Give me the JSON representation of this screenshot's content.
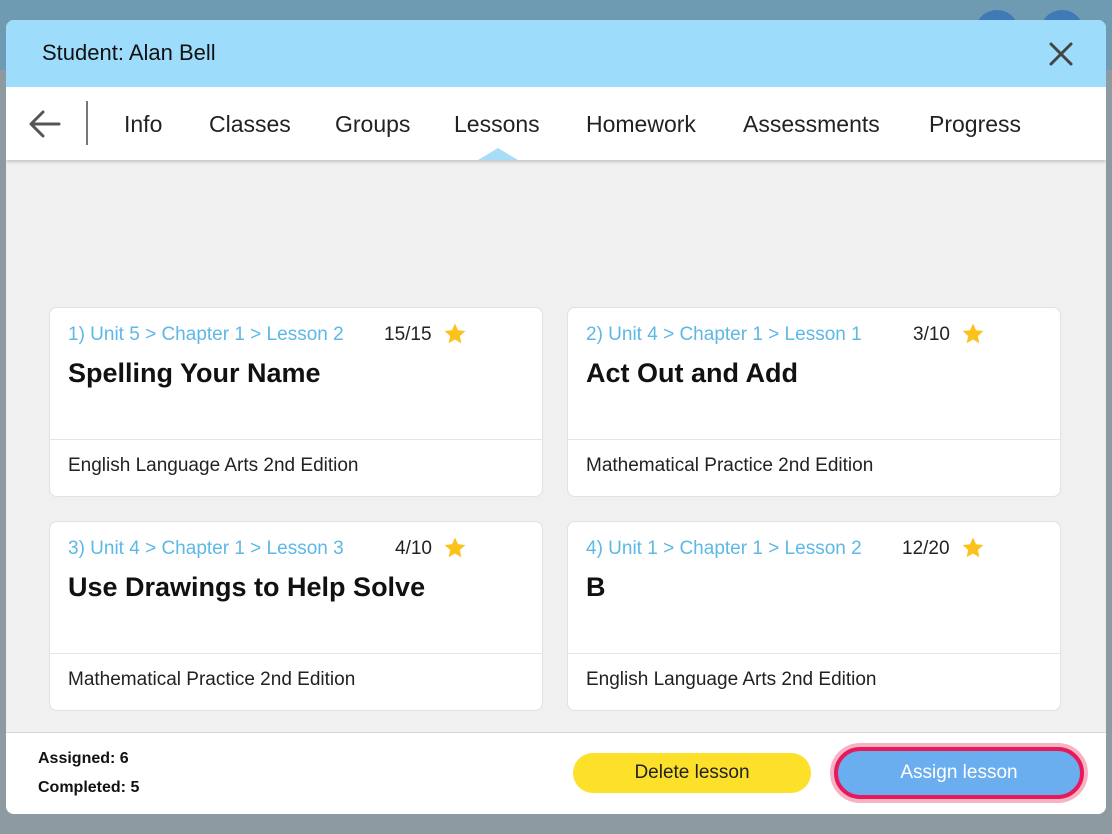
{
  "modal": {
    "title": "Student: Alan Bell"
  },
  "tabs": [
    {
      "label": "Info"
    },
    {
      "label": "Classes"
    },
    {
      "label": "Groups"
    },
    {
      "label": "Lessons"
    },
    {
      "label": "Homework"
    },
    {
      "label": "Assessments"
    },
    {
      "label": "Progress"
    }
  ],
  "active_tab": "Lessons",
  "lessons": [
    {
      "path": "1) Unit 5 > Chapter 1 > Lesson 2",
      "score": "15/15",
      "title": "Spelling Your Name",
      "course": "English Language Arts 2nd Edition"
    },
    {
      "path": "2) Unit 4 > Chapter 1 > Lesson 1",
      "score": "3/10",
      "title": "Act Out and Add",
      "course": "Mathematical Practice 2nd Edition"
    },
    {
      "path": "3) Unit 4 > Chapter 1 > Lesson 3",
      "score": "4/10",
      "title": "Use Drawings to Help Solve",
      "course": "Mathematical Practice 2nd Edition"
    },
    {
      "path": "4) Unit 1 > Chapter 1 > Lesson 2",
      "score": "12/20",
      "title": "B",
      "course": "English Language Arts 2nd Edition"
    }
  ],
  "footer": {
    "assigned": "Assigned: 6",
    "completed": "Completed: 5",
    "delete_label": "Delete lesson",
    "assign_label": "Assign lesson"
  },
  "colors": {
    "header_bg": "#9edcfc",
    "path_text": "#5db8e6",
    "star": "#fbc21b",
    "delete_button": "#fde02a",
    "assign_button": "#6aaef0",
    "assign_highlight": "#e8195a"
  },
  "icons": {
    "close": "close-icon",
    "back": "arrow-left-icon",
    "star": "star-icon"
  }
}
